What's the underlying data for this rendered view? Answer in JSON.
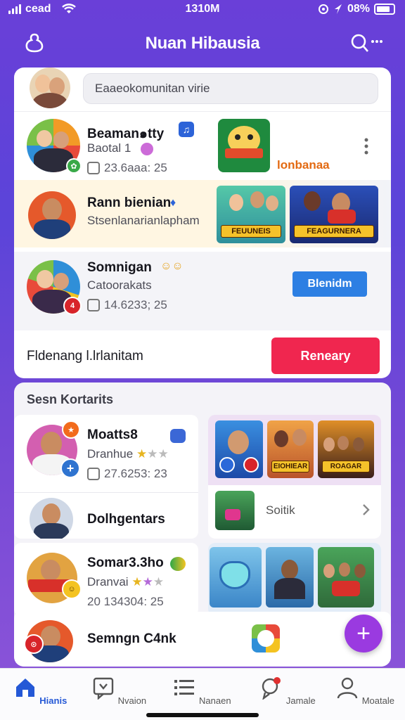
{
  "status_bar": {
    "carrier": "cead",
    "time": "1310M",
    "battery": "08%"
  },
  "header": {
    "title": "Nuan Hibausia",
    "left_icon": "profile-blob-icon",
    "right_icon": "search-more-icon"
  },
  "search": {
    "placeholder": "Eaaeokomunitan virie"
  },
  "feed": [
    {
      "name": "Beaman๑tty",
      "sub": "Baotal 1",
      "meta": "23.6aaa: 25",
      "caption": "lonbanaa"
    },
    {
      "name": "Rann bienian",
      "sub": "Stsenlanarianlapham",
      "thumb_labels": [
        "FEUUNEIS",
        "FEAGURNERA"
      ]
    },
    {
      "name": "Somnigan",
      "sub": "Catoorakats",
      "meta": "14.6233; 25",
      "action_label": "Blenidm"
    }
  ],
  "footer_row": {
    "text": "Fldenang l.lrlanitam",
    "action_label": "Reneary"
  },
  "contacts": {
    "title": "Sesn Kortarits",
    "items": [
      {
        "name": "Moatts8",
        "sub": "Dranhue",
        "meta": "27.6253: 23"
      },
      {
        "name": "Dolhgentars"
      },
      {
        "name": "Somar3.3ho",
        "sub": "Dranvai",
        "meta": "20 134304: 25"
      },
      {
        "name": "Semngn C4nk"
      }
    ],
    "grid_thumb_labels": [
      "EIOHIEAR",
      "ROAGAR"
    ],
    "link_text": "Soitik"
  },
  "bottom_nav": [
    {
      "label": "Hianis",
      "icon": "home-icon",
      "active": true
    },
    {
      "label": "Nvaion",
      "icon": "chat-icon",
      "active": false
    },
    {
      "label": "Nanaen",
      "icon": "list-icon",
      "active": false
    },
    {
      "label": "Jamale",
      "icon": "location-icon",
      "active": false
    },
    {
      "label": "Moatale",
      "icon": "person-icon",
      "active": false
    }
  ]
}
